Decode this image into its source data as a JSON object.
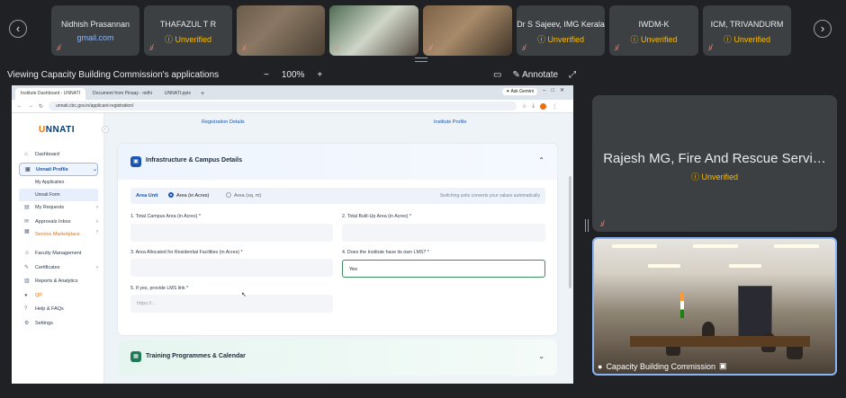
{
  "participants": [
    {
      "name": "Nidhish Prasannan",
      "sub": "gmail.com",
      "sub_type": "domain"
    },
    {
      "name": "THAFAZUL T R",
      "sub": "Unverified",
      "sub_type": "unverified"
    },
    {
      "name": "",
      "sub": "",
      "sub_type": "video"
    },
    {
      "name": "",
      "sub": "",
      "sub_type": "video"
    },
    {
      "name": "",
      "sub": "",
      "sub_type": "video"
    },
    {
      "name": "Dr S Sajeev, IMG Kerala",
      "sub": "Unverified",
      "sub_type": "unverified"
    },
    {
      "name": "IWDM-K",
      "sub": "Unverified",
      "sub_type": "unverified"
    },
    {
      "name": "ICM, TRIVANDURM",
      "sub": "Unverified",
      "sub_type": "unverified"
    }
  ],
  "presentation": {
    "title": "Viewing Capacity Building Commission's applications",
    "zoom": "100%",
    "zoom_out": "−",
    "zoom_in": "+",
    "annotate": "Annotate"
  },
  "browser": {
    "tabs": [
      "Institute Dashboard - UNNATI",
      "Document from Pinaay - nidhi",
      "UNNATI.pptx"
    ],
    "new_tab": "+",
    "gemini": "Ask Gemini",
    "url": "unnati.cbc.gov.in/applicant-registration/"
  },
  "app": {
    "logo_prefix": "U",
    "logo_rest": "NNATI",
    "menu": [
      {
        "label": "Dashboard",
        "icon": "⌂",
        "style": "normal",
        "chevron": ""
      },
      {
        "label": "Unnati Profile",
        "icon": "▣",
        "style": "active",
        "chevron": "⌄"
      },
      {
        "label": "My Application",
        "icon": "",
        "style": "sub",
        "chevron": ""
      },
      {
        "label": "Unnati Form",
        "icon": "",
        "style": "sub current",
        "chevron": ""
      },
      {
        "label": "My Requests",
        "icon": "▤",
        "style": "normal",
        "chevron": "›"
      },
      {
        "label": "Approvals Inbox",
        "icon": "✉",
        "style": "normal",
        "chevron": "›"
      },
      {
        "label": "Service Marketplace",
        "icon": "▦",
        "style": "orange two",
        "chevron": "›"
      },
      {
        "label": "Faculty Management",
        "icon": "☺",
        "style": "normal",
        "chevron": ""
      },
      {
        "label": "Certificates",
        "icon": "✎",
        "style": "normal",
        "chevron": "›"
      },
      {
        "label": "Reports & Analytics",
        "icon": "▥",
        "style": "normal",
        "chevron": ""
      },
      {
        "label": "QP",
        "icon": "●",
        "style": "orange",
        "chevron": ""
      },
      {
        "label": "Help & FAQs",
        "icon": "?",
        "style": "normal",
        "chevron": ""
      },
      {
        "label": "Settings",
        "icon": "⚙",
        "style": "normal",
        "chevron": ""
      }
    ],
    "steps": [
      "Registration Details",
      "Institute Profile"
    ],
    "section": {
      "title": "Infrastructure & Campus Details",
      "area_unit_label": "Area Unit",
      "unit_option_1": "Area (in Acres)",
      "unit_option_2": "Area (sq. m)",
      "unit_hint": "Switching units converts your values automatically",
      "fields": [
        {
          "label": "1. Total Campus Area (in Acres) *",
          "value": "",
          "placeholder": ""
        },
        {
          "label": "2. Total Built-Up Area (in Acres) *",
          "value": "",
          "placeholder": ""
        },
        {
          "label": "3. Area Allocated for Residential Facilities (in Acres) *",
          "value": "",
          "placeholder": ""
        },
        {
          "label": "4. Does the Institute have its own LMS? *",
          "value": "Yes",
          "placeholder": ""
        },
        {
          "label": "5. If yes, provide LMS link *",
          "value": "",
          "placeholder": "https://..."
        }
      ]
    },
    "section2": {
      "title": "Training Programmes & Calendar"
    }
  },
  "speaker": {
    "name": "Rajesh MG, Fire And Rescue Servi…",
    "status": "Unverified"
  },
  "room": {
    "label": "Capacity Building Commission"
  }
}
